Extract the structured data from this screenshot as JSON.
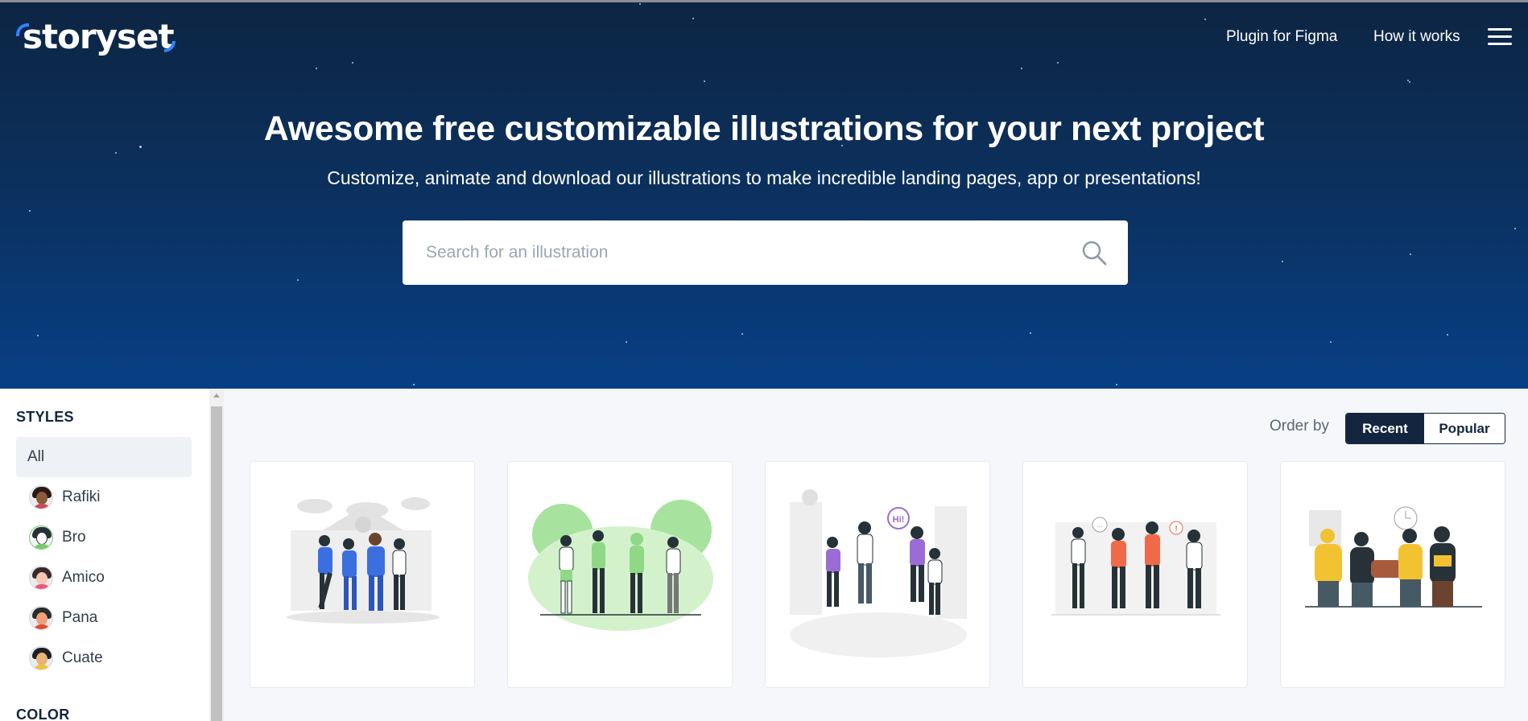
{
  "header": {
    "logo_text": "storyset",
    "nav": [
      "Plugin for Figma",
      "How it works"
    ],
    "menu_icon": "hamburger-icon"
  },
  "hero": {
    "title": "Awesome free customizable illustrations for your next project",
    "subtitle": "Customize, animate and download our illustrations to make incredible landing pages, app or presentations!",
    "search_placeholder": "Search for an illustration",
    "search_icon": "search-icon"
  },
  "sidebar": {
    "styles_heading": "STYLES",
    "styles": [
      {
        "label": "All",
        "active": true
      },
      {
        "label": "Rafiki",
        "active": false
      },
      {
        "label": "Bro",
        "active": false
      },
      {
        "label": "Amico",
        "active": false
      },
      {
        "label": "Pana",
        "active": false
      },
      {
        "label": "Cuate",
        "active": false
      }
    ],
    "color_heading": "COLOR"
  },
  "main": {
    "order_label": "Order by",
    "order_options": [
      {
        "label": "Recent",
        "active": true
      },
      {
        "label": "Popular",
        "active": false
      }
    ],
    "cards": [
      {
        "accent": "#3b6fe0",
        "theme": "students-walking"
      },
      {
        "accent": "#7ed07a",
        "theme": "group-in-park"
      },
      {
        "accent": "#9b6cd6",
        "theme": "friends-at-lockers"
      },
      {
        "accent": "#f06a4a",
        "theme": "students-chatting"
      },
      {
        "accent": "#f2c230",
        "theme": "study-group"
      }
    ]
  },
  "colors": {
    "hero_top": "#0d2543",
    "hero_bottom": "#073f86",
    "brand_dark": "#14263f",
    "logo_accent": "#2f86ff"
  }
}
